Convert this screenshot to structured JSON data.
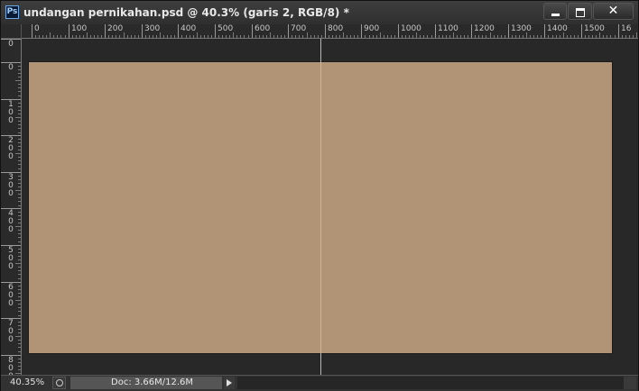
{
  "window": {
    "title": "undangan pernikahan.psd @ 40.3% (garis 2, RGB/8) *",
    "app_icon_label": "Ps",
    "close_glyph": "✕",
    "background_color": "#b09475",
    "guide_color": "#4fe0ff"
  },
  "ruler": {
    "top_labels": [
      "0",
      "100",
      "200",
      "300",
      "400",
      "500",
      "600",
      "700",
      "800",
      "900",
      "1000",
      "1100",
      "1200",
      "1300",
      "1400",
      "1500",
      "16"
    ],
    "left_labels": [
      "0",
      "0",
      "100",
      "200",
      "300",
      "400",
      "500",
      "600",
      "700",
      "800"
    ]
  },
  "status": {
    "zoom": "40.35%",
    "doc_info": "Doc: 3.66M/12.6M"
  }
}
